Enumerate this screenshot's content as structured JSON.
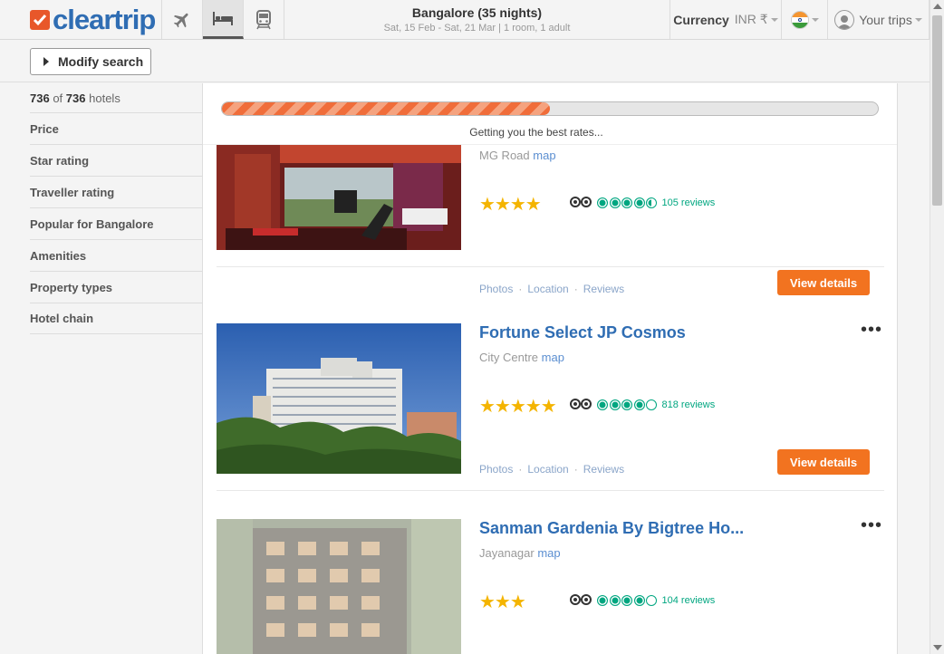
{
  "header": {
    "logo_text": "cleartrip",
    "nav": [
      {
        "icon": "plane-icon"
      },
      {
        "icon": "bed-icon",
        "active": true
      },
      {
        "icon": "train-icon"
      }
    ],
    "trip": {
      "city": "Bangalore (35 nights)",
      "dates": "Sat, 15 Feb - Sat, 21 Mar | 1 room, 1 adult"
    },
    "currency": {
      "label": "Currency",
      "value": "INR ₹"
    },
    "country_flag": "india-flag-icon",
    "trips_label": "Your trips"
  },
  "toolbar": {
    "modify_label": "Modify search"
  },
  "sidebar": {
    "count_shown": "736",
    "count_of": "of",
    "count_total": "736",
    "count_suffix": "hotels",
    "filters": [
      "Price",
      "Star rating",
      "Traveller rating",
      "Popular for Bangalore",
      "Amenities",
      "Property types",
      "Hotel chain"
    ]
  },
  "progress": {
    "percent": 50,
    "text": "Getting you the best rates..."
  },
  "hotels": [
    {
      "name": "",
      "area": "MG Road",
      "map_label": "map",
      "stars": "★★★★",
      "ta_rating": 4.5,
      "reviews": "105 reviews",
      "links": [
        "Photos",
        "Location",
        "Reviews"
      ],
      "cta": "View details"
    },
    {
      "name": "Fortune Select JP Cosmos",
      "area": "City Centre",
      "map_label": "map",
      "stars": "★★★★★",
      "ta_rating": 4.0,
      "reviews": "818 reviews",
      "links": [
        "Photos",
        "Location",
        "Reviews"
      ],
      "cta": "View details"
    },
    {
      "name": "Sanman Gardenia By Bigtree Ho...",
      "area": "Jayanagar",
      "map_label": "map",
      "stars": "★★★",
      "ta_rating": 4.0,
      "reviews": "104 reviews",
      "links": [
        "Photos",
        "Location",
        "Reviews"
      ],
      "cta": "View details"
    }
  ],
  "colors": {
    "brand_blue": "#2f6db3",
    "accent_orange": "#f27320",
    "tripadvisor_green": "#00a680",
    "star_gold": "#f4b400"
  }
}
